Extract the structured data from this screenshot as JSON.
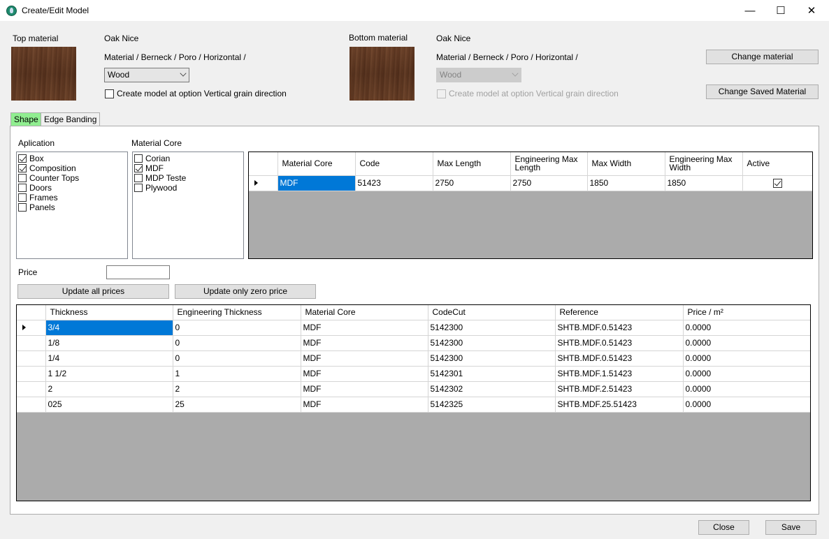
{
  "window": {
    "title": "Create/Edit Model",
    "minimize_glyph": "—",
    "maximize_glyph": "☐",
    "close_glyph": "✕"
  },
  "top_material": {
    "label": "Top material",
    "name": "Oak Nice",
    "path": "Material / Berneck / Poro / Horizontal /",
    "type_value": "Wood",
    "vertical_grain_label": "Create model at option Vertical grain direction",
    "vertical_grain_checked": false
  },
  "bottom_material": {
    "label": "Bottom material",
    "name": "Oak Nice",
    "path": "Material / Berneck / Poro / Horizontal /",
    "type_value": "Wood",
    "vertical_grain_label": "Create model at option Vertical grain direction",
    "vertical_grain_checked": false
  },
  "buttons": {
    "change_material": "Change material",
    "change_saved_material": "Change Saved Material",
    "update_all_prices": "Update all prices",
    "update_only_zero_price": "Update only zero price",
    "close": "Close",
    "save": "Save"
  },
  "tabs": [
    {
      "label": "Shape",
      "active": true
    },
    {
      "label": "Edge Banding",
      "active": false
    }
  ],
  "application": {
    "label": "Aplication",
    "items": [
      {
        "label": "Box",
        "checked": true
      },
      {
        "label": "Composition",
        "checked": true
      },
      {
        "label": "Counter Tops",
        "checked": false
      },
      {
        "label": "Doors",
        "checked": false
      },
      {
        "label": "Frames",
        "checked": false
      },
      {
        "label": "Panels",
        "checked": false
      }
    ]
  },
  "material_core": {
    "label": "Material Core",
    "items": [
      {
        "label": "Corian",
        "checked": false
      },
      {
        "label": "MDF",
        "checked": true
      },
      {
        "label": "MDP Teste",
        "checked": false
      },
      {
        "label": "Plywood",
        "checked": false
      }
    ]
  },
  "core_grid": {
    "headers": [
      "Material Core",
      "Code",
      "Max Length",
      "Engineering Max Length",
      "Max Width",
      "Engineering Max Width",
      "Active"
    ],
    "rows": [
      {
        "material_core": "MDF",
        "code": "51423",
        "max_length": "2750",
        "eng_max_length": "2750",
        "max_width": "1850",
        "eng_max_width": "1850",
        "active": true
      }
    ]
  },
  "price": {
    "label": "Price",
    "value": ""
  },
  "thickness_grid": {
    "headers": [
      "Thickness",
      "Engineering Thickness",
      "Material Core",
      "CodeCut",
      "Reference",
      "Price / m²"
    ],
    "rows": [
      {
        "thickness": "3/4",
        "eng": "0",
        "core": "MDF",
        "codecut": "5142300",
        "reference": "SHTB.MDF.0.51423",
        "price": "0.0000"
      },
      {
        "thickness": "1/8",
        "eng": "0",
        "core": "MDF",
        "codecut": "5142300",
        "reference": "SHTB.MDF.0.51423",
        "price": "0.0000"
      },
      {
        "thickness": "1/4",
        "eng": "0",
        "core": "MDF",
        "codecut": "5142300",
        "reference": "SHTB.MDF.0.51423",
        "price": "0.0000"
      },
      {
        "thickness": "1 1/2",
        "eng": "1",
        "core": "MDF",
        "codecut": "5142301",
        "reference": "SHTB.MDF.1.51423",
        "price": "0.0000"
      },
      {
        "thickness": "2",
        "eng": "2",
        "core": "MDF",
        "codecut": "5142302",
        "reference": "SHTB.MDF.2.51423",
        "price": "0.0000"
      },
      {
        "thickness": "025",
        "eng": "25",
        "core": "MDF",
        "codecut": "5142325",
        "reference": "SHTB.MDF.25.51423",
        "price": "0.0000"
      }
    ]
  }
}
